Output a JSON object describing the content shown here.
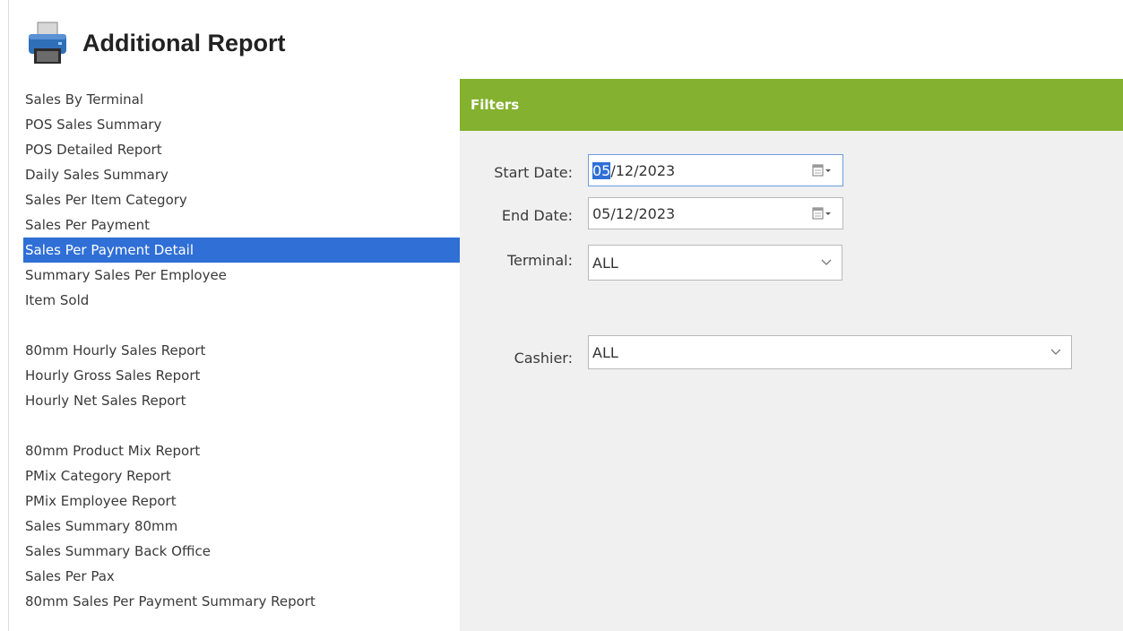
{
  "header": {
    "title": "Additional Report",
    "icon": "printer-icon"
  },
  "reports": {
    "selected_index": 6,
    "group1": [
      "Sales By Terminal",
      "POS Sales Summary",
      "POS Detailed Report",
      "Daily Sales Summary",
      "Sales Per Item Category",
      "Sales Per Payment",
      "Sales Per Payment Detail",
      "Summary Sales Per Employee",
      "Item Sold"
    ],
    "group2": [
      "80mm Hourly Sales Report",
      "Hourly Gross Sales Report",
      "Hourly Net Sales Report"
    ],
    "group3": [
      "80mm Product Mix Report",
      "PMix Category Report",
      "PMix Employee Report",
      "Sales Summary 80mm",
      "Sales Summary Back Office",
      "Sales Per Pax",
      "80mm Sales Per Payment Summary Report"
    ]
  },
  "filters": {
    "title": "Filters",
    "start_date": {
      "label": "Start Date:",
      "month": "05",
      "rest": "/12/2023"
    },
    "end_date": {
      "label": "End Date:",
      "value": "05/12/2023"
    },
    "terminal": {
      "label": "Terminal:",
      "value": "ALL"
    },
    "cashier": {
      "label": "Cashier:",
      "value": "ALL"
    }
  },
  "colors": {
    "accent_green": "#84b12f",
    "selection_blue": "#2f6fd6",
    "panel_bg": "#f0f0f0"
  }
}
